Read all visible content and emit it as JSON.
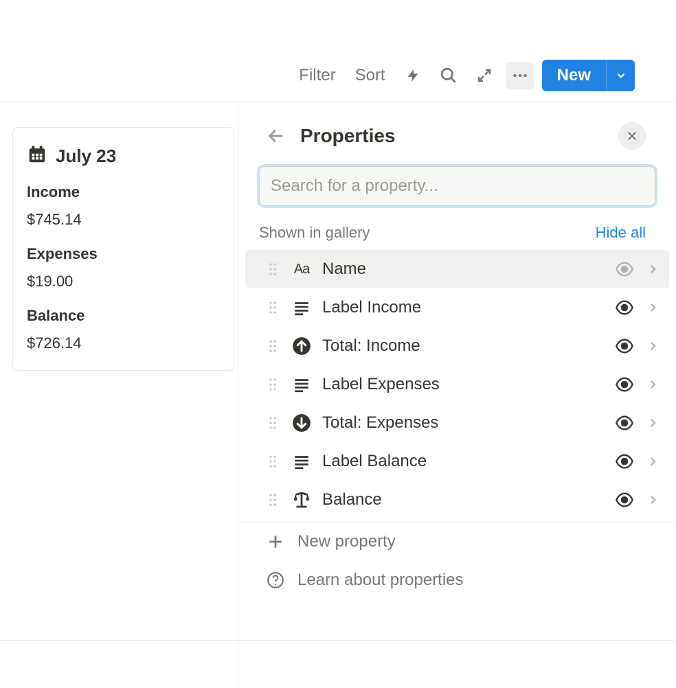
{
  "toolbar": {
    "filter": "Filter",
    "sort": "Sort",
    "new": "New"
  },
  "card": {
    "title": "July 23",
    "rows": [
      {
        "label": "Income",
        "value": "$745.14"
      },
      {
        "label": "Expenses",
        "value": "$19.00"
      },
      {
        "label": "Balance",
        "value": "$726.14"
      }
    ]
  },
  "panel": {
    "title": "Properties",
    "search_placeholder": "Search for a property...",
    "section_title": "Shown in gallery",
    "hide_all": "Hide all",
    "properties": [
      {
        "icon": "aa",
        "label": "Name",
        "highlighted": true,
        "eye_dimmed": true
      },
      {
        "icon": "text",
        "label": "Label Income"
      },
      {
        "icon": "up",
        "label": "Total: Income"
      },
      {
        "icon": "text",
        "label": "Label Expenses"
      },
      {
        "icon": "down",
        "label": "Total: Expenses"
      },
      {
        "icon": "text",
        "label": "Label Balance"
      },
      {
        "icon": "balance",
        "label": "Balance"
      }
    ],
    "new_property": "New property",
    "learn": "Learn about properties"
  }
}
